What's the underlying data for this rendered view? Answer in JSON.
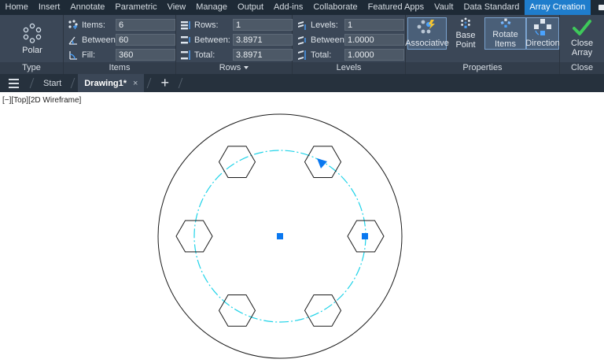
{
  "menu": {
    "tabs": [
      "Home",
      "Insert",
      "Annotate",
      "Parametric",
      "View",
      "Manage",
      "Output",
      "Add-ins",
      "Collaborate",
      "Featured Apps",
      "Vault",
      "Data Standard",
      "Array Creation"
    ]
  },
  "ribbon": {
    "type_panel": {
      "title": "Type",
      "button": "Polar"
    },
    "items_panel": {
      "title": "Items",
      "items_label": "Items:",
      "items_value": "6",
      "between_label": "Between:",
      "between_value": "60",
      "fill_label": "Fill:",
      "fill_value": "360"
    },
    "rows_panel": {
      "title": "Rows",
      "rows_label": "Rows:",
      "rows_value": "1",
      "between_label": "Between:",
      "between_value": "3.8971",
      "total_label": "Total:",
      "total_value": "3.8971"
    },
    "levels_panel": {
      "title": "Levels",
      "levels_label": "Levels:",
      "levels_value": "1",
      "between_label": "Between:",
      "between_value": "1.0000",
      "total_label": "Total:",
      "total_value": "1.0000"
    },
    "properties_panel": {
      "title": "Properties",
      "associative": "Associative",
      "base_point": "Base Point",
      "rotate_items": "Rotate Items",
      "direction": "Direction"
    },
    "close_panel": {
      "title": "Close",
      "button_line1": "Close",
      "button_line2": "Array"
    }
  },
  "file_tabs": {
    "start": "Start",
    "drawing": "Drawing1*",
    "close_glyph": "×",
    "new_glyph": "+"
  },
  "viewport": {
    "label": "[−][Top][2D Wireframe]"
  },
  "colors": {
    "accent": "#1f7dcc",
    "path_circle": "#1fd3e8",
    "grip": "#0a78f0"
  }
}
